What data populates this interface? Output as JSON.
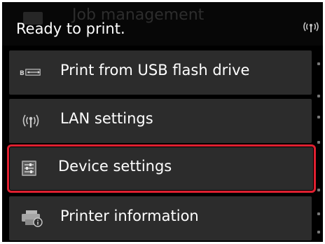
{
  "status": {
    "ghost_title": "Job management",
    "text": "Ready to print.",
    "signal_icon": "wifi-signal-icon",
    "signal_glyph": "((ᴛ))"
  },
  "menu": {
    "items": [
      {
        "label": "Print from USB flash drive",
        "icon": "usb-flash-drive-icon",
        "selected": false
      },
      {
        "label": "LAN settings",
        "icon": "lan-wireless-icon",
        "selected": false
      },
      {
        "label": "Device settings",
        "icon": "device-settings-icon",
        "selected": true
      },
      {
        "label": "Printer information",
        "icon": "printer-info-icon",
        "selected": false
      }
    ]
  },
  "colors": {
    "background": "#000000",
    "item_background": "#2c2c2c",
    "selection_border": "#e02030",
    "text": "#ffffff"
  }
}
